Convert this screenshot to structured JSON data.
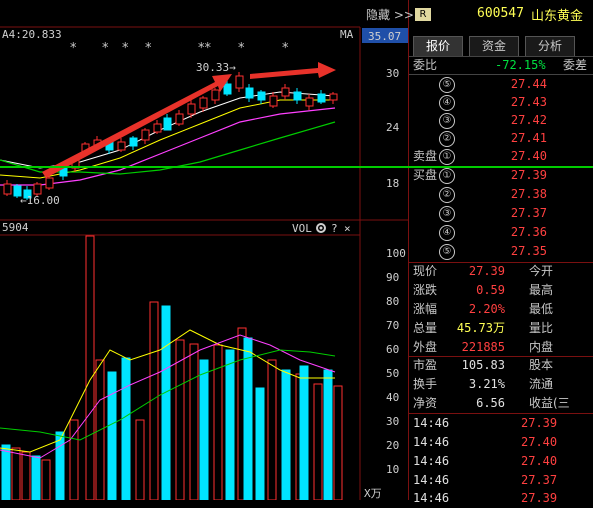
{
  "topbar": {
    "hide_label": "隐藏 >>",
    "badge": "R",
    "code": "600547",
    "name": "山东黄金"
  },
  "kline": {
    "ma_label": "A4:20.833",
    "ma_tag": "MA",
    "price_tag": "35.07",
    "high_note": "30.33→",
    "low_note": "←16.00",
    "y_ticks": [
      "30",
      "24",
      "18"
    ],
    "stars": [
      "*",
      "*",
      "*",
      "*",
      "**",
      "*",
      "*"
    ]
  },
  "volume_panel": {
    "left_tag": "5904",
    "vol_label": "VOL",
    "gear_icon": "gear-icon",
    "help": "?",
    "close": "×",
    "y_ticks": [
      "100",
      "90",
      "80",
      "70",
      "60",
      "50",
      "40",
      "30",
      "20",
      "10"
    ],
    "unit": "X万"
  },
  "tabs": [
    {
      "label": "报价",
      "active": true
    },
    {
      "label": "资金",
      "active": false
    },
    {
      "label": "分析",
      "active": false
    }
  ],
  "ratio": {
    "label": "委比",
    "value": "-72.15%",
    "label2": "委差"
  },
  "asks": [
    {
      "num": "⑤",
      "price": "27.44"
    },
    {
      "num": "④",
      "price": "27.43"
    },
    {
      "num": "③",
      "price": "27.42"
    },
    {
      "num": "②",
      "price": "27.41"
    },
    {
      "num": "①",
      "price": "27.40",
      "prefix": "卖盘"
    }
  ],
  "bids": [
    {
      "num": "①",
      "price": "27.39",
      "prefix": "买盘"
    },
    {
      "num": "②",
      "price": "27.38"
    },
    {
      "num": "③",
      "price": "27.37"
    },
    {
      "num": "④",
      "price": "27.36"
    },
    {
      "num": "⑤",
      "price": "27.35"
    }
  ],
  "quote": [
    {
      "l1": "现价",
      "v1": "27.39",
      "c1": "#ff4040",
      "l2": "今开"
    },
    {
      "l1": "涨跌",
      "v1": "0.59",
      "c1": "#ff4040",
      "l2": "最高"
    },
    {
      "l1": "涨幅",
      "v1": "2.20%",
      "c1": "#ff4040",
      "l2": "最低"
    },
    {
      "l1": "总量",
      "v1": "45.73万",
      "c1": "#ffff55",
      "l2": "量比"
    },
    {
      "l1": "外盘",
      "v1": "221885",
      "c1": "#ff4040",
      "l2": "内盘"
    }
  ],
  "stats": [
    {
      "l1": "市盈",
      "v1": "105.83",
      "l2": "股本"
    },
    {
      "l1": "换手",
      "v1": "3.21%",
      "l2": "流通"
    },
    {
      "l1": "净资",
      "v1": "6.56",
      "l2": "收益(三"
    }
  ],
  "trades": [
    {
      "time": "14:46",
      "price": "27.39"
    },
    {
      "time": "14:46",
      "price": "27.40"
    },
    {
      "time": "14:46",
      "price": "27.40"
    },
    {
      "time": "14:46",
      "price": "27.37"
    },
    {
      "time": "14:46",
      "price": "27.39"
    }
  ],
  "colors": {
    "up": "#ff3030",
    "down": "#00e5ff",
    "ma5": "#ffffff",
    "ma10": "#ffff00",
    "ma20": "#ff40ff",
    "ma60": "#00cc00"
  }
}
